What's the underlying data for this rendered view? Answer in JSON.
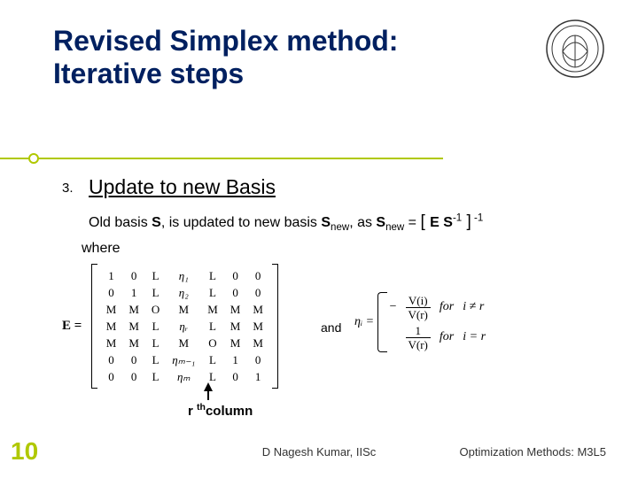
{
  "title_line1": "Revised Simplex method:",
  "title_line2": "Iterative steps",
  "step": {
    "num": "3.",
    "title": "Update to new Basis"
  },
  "body_prefix": "Old basis ",
  "body_S": "S",
  "body_mid": ", is updated to new basis ",
  "body_Snew1": "S",
  "body_Snew1_sub": "new",
  "body_as": ", as ",
  "body_Snew2": "S",
  "body_Snew2_sub": "new",
  "body_eq": " = ",
  "body_br_open": "[ ",
  "body_E": "E S",
  "body_exp1": "-1",
  "body_br_close": " ]",
  "body_exp2": " -1",
  "where": "where",
  "matrix_label": "E =",
  "matrix_rows": [
    [
      "1",
      "0",
      "L",
      "η₁",
      "L",
      "0",
      "0"
    ],
    [
      "0",
      "1",
      "L",
      "η₂",
      "L",
      "0",
      "0"
    ],
    [
      "M",
      "M",
      "O",
      "M",
      "M",
      "M",
      "M"
    ],
    [
      "M",
      "M",
      "L",
      "ηᵣ",
      "L",
      "M",
      "M"
    ],
    [
      "M",
      "M",
      "L",
      "M",
      "O",
      "M",
      "M"
    ],
    [
      "0",
      "0",
      "L",
      "ηₘ₋₁",
      "L",
      "1",
      "0"
    ],
    [
      "0",
      "0",
      "L",
      "ηₘ",
      "L",
      "0",
      "1"
    ]
  ],
  "and": "and",
  "eta_lhs": "ηᵢ =",
  "eta_case1_num": "V(i)",
  "eta_case1_den": "V(r)",
  "eta_case1_prefix": "−",
  "eta_case1_cond_for": "for",
  "eta_case1_cond": "i ≠ r",
  "eta_case2_num": "1",
  "eta_case2_den": "V(r)",
  "eta_case2_cond_for": "for",
  "eta_case2_cond": "i = r",
  "rcol_label_r": "r ",
  "rcol_label_th": "th",
  "rcol_label_col": "column",
  "slide_num": "10",
  "footer_center": "D Nagesh Kumar, IISc",
  "footer_right": "Optimization Methods: M3L5"
}
